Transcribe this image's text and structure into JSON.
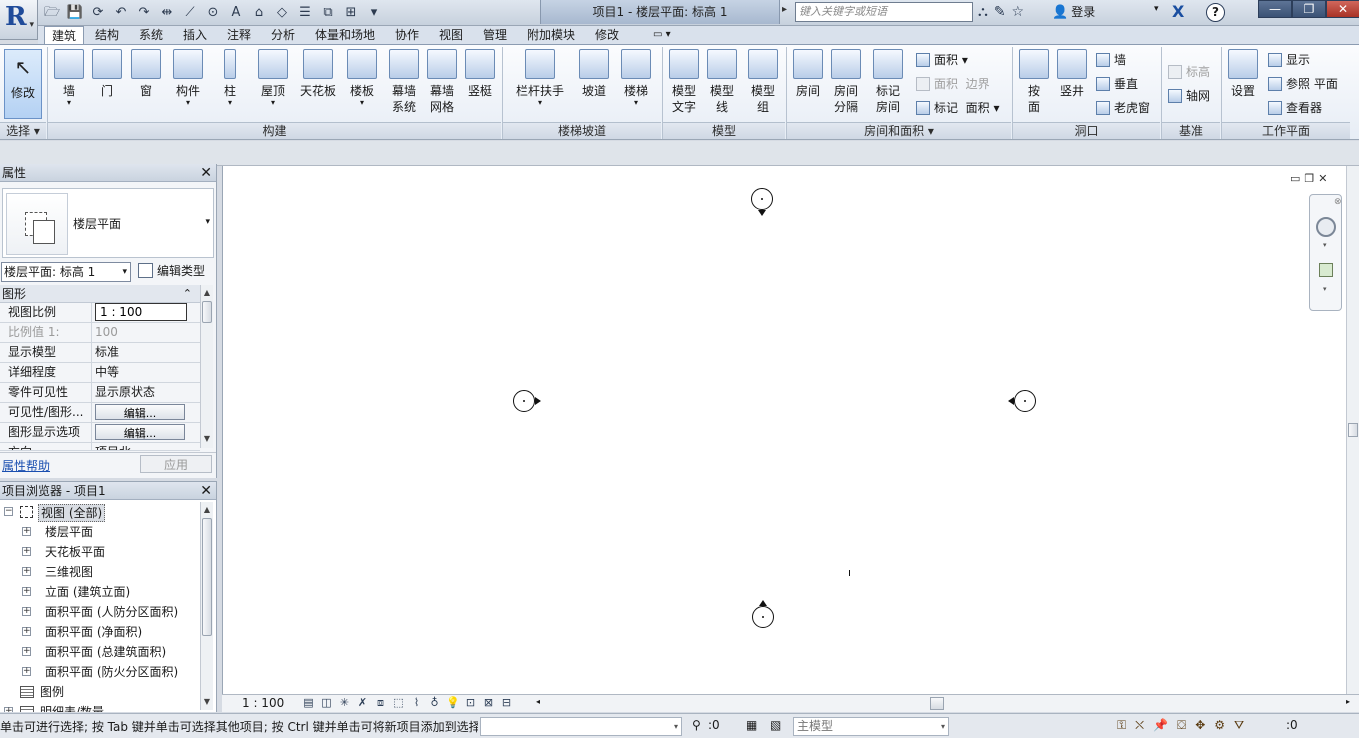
{
  "titlebar": {
    "app_letter": "R",
    "window_title": "项目1 - 楼层平面: 标高 1",
    "search_placeholder": "键入关键字或短语",
    "login_label": "登录",
    "help_glyph": "?",
    "x_glyph": "X"
  },
  "tabs": [
    "建筑",
    "结构",
    "系统",
    "插入",
    "注释",
    "分析",
    "体量和场地",
    "协作",
    "视图",
    "管理",
    "附加模块",
    "修改"
  ],
  "ribbon": {
    "select": {
      "label": "修改",
      "panel": "选择"
    },
    "build_panel": "构建",
    "build_tools": [
      "墙",
      "门",
      "窗",
      "构件",
      "柱",
      "屋顶",
      "天花板",
      "楼板"
    ],
    "curtain_system_l1": "幕墙",
    "curtain_system_l2": "系统",
    "curtain_grid_l1": "幕墙",
    "curtain_grid_l2": "网格",
    "mullion": "竖梃",
    "circulation_panel": "楼梯坡道",
    "circulation_tools": [
      "栏杆扶手",
      "坡道",
      "楼梯"
    ],
    "model_panel": "模型",
    "model_text_l1": "模型",
    "model_text_l2": "文字",
    "model_line_l1": "模型",
    "model_line_l2": "线",
    "model_group_l1": "模型",
    "model_group_l2": "组",
    "room_panel": "房间和面积",
    "room": "房间",
    "room_sep_l1": "房间",
    "room_sep_l2": "分隔",
    "tag_room_l1": "标记",
    "tag_room_l2": "房间",
    "area": "面积",
    "area_boundary_1": "面积",
    "area_boundary_2": "边界",
    "tag_area_1": "标记",
    "tag_area_2": "面积",
    "opening_panel": "洞口",
    "by_face_l1": "按",
    "by_face_l2": "面",
    "shaft": "竖井",
    "wall_opening": "墙",
    "vertical": "垂直",
    "dormer": "老虎窗",
    "datum_panel": "基准",
    "level": "标高",
    "grid": "轴网",
    "workplane_panel": "工作平面",
    "set": "设置",
    "show": "显示",
    "ref_plane": "参照 平面",
    "viewer": "查看器"
  },
  "properties": {
    "title": "属性",
    "type_name": "楼层平面",
    "instance": "楼层平面: 标高 1",
    "edit_type": "编辑类型",
    "category": "图形",
    "rows": [
      {
        "key": "视图比例",
        "value": "1 : 100"
      },
      {
        "key": "比例值 1:",
        "value": "100"
      },
      {
        "key": "显示模型",
        "value": "标准"
      },
      {
        "key": "详细程度",
        "value": "中等"
      },
      {
        "key": "零件可见性",
        "value": "显示原状态"
      },
      {
        "key": "可见性/图形...",
        "value": "编辑..."
      },
      {
        "key": "图形显示选项",
        "value": "编辑..."
      },
      {
        "key": "方向",
        "value": "项目北"
      }
    ],
    "help_link": "属性帮助",
    "apply_label": "应用"
  },
  "browser": {
    "title": "项目浏览器 - 项目1",
    "root": "视图 (全部)",
    "nodes": [
      "楼层平面",
      "天花板平面",
      "三维视图",
      "立面 (建筑立面)",
      "面积平面 (人防分区面积)",
      "面积平面 (净面积)",
      "面积平面 (总建筑面积)",
      "面积平面 (防火分区面积)"
    ],
    "legend": "图例",
    "schedules": "明细表/数量"
  },
  "viewbar": {
    "scale": "1 : 100"
  },
  "statusbar": {
    "message": "单击可进行选择; 按 Tab 键并单击可选择其他项目; 按 Ctrl 键并单击可将新项目添加到选择集",
    "worksets_count": ":0",
    "main_model": "主模型",
    "filter_count": ":0"
  },
  "colors": {
    "ribbon_blue": "#b9cde8",
    "app_blue": "#1f4b9a",
    "close_red": "#a83226",
    "link_blue": "#1a4fb0"
  }
}
